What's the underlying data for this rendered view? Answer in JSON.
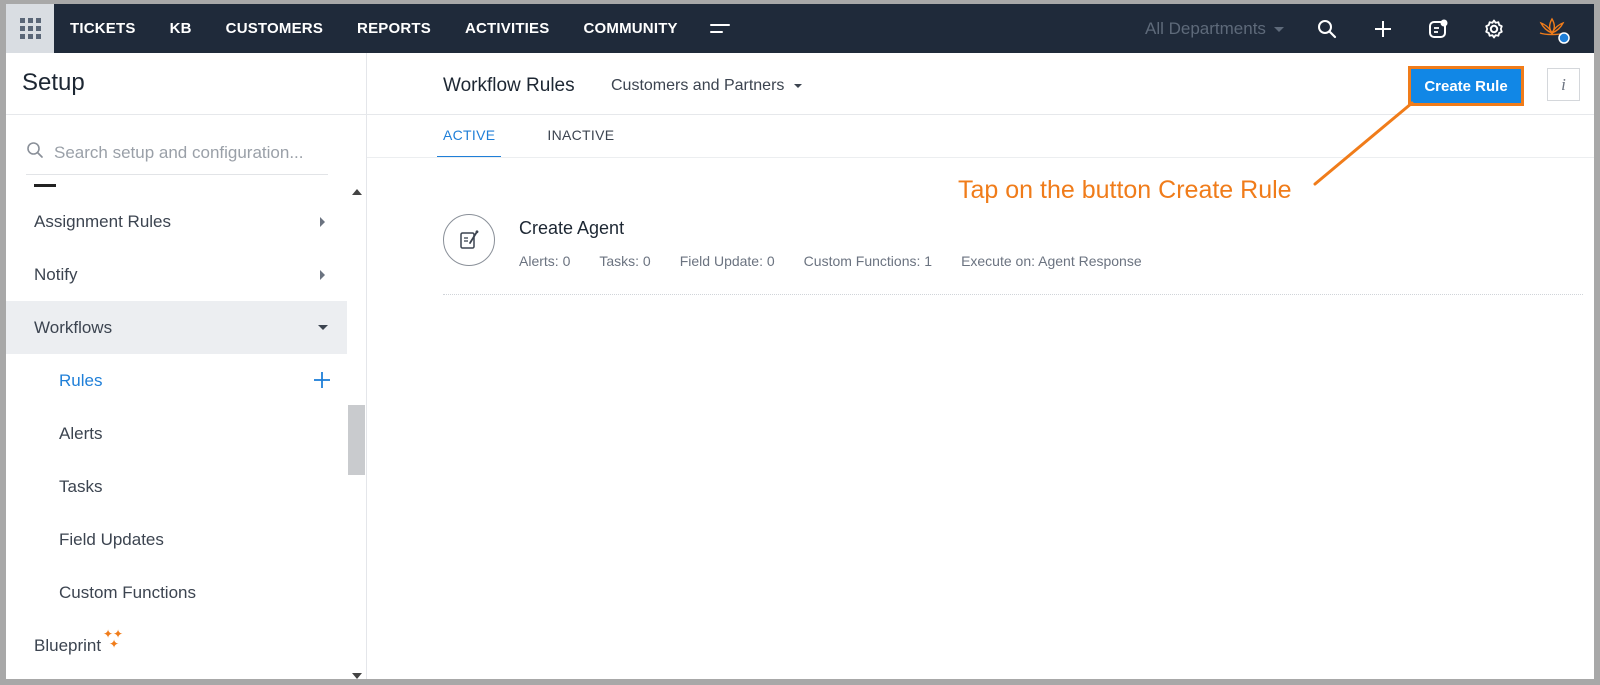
{
  "topbar": {
    "nav": [
      "TICKETS",
      "KB",
      "CUSTOMERS",
      "REPORTS",
      "ACTIVITIES",
      "COMMUNITY"
    ],
    "department_label": "All Departments"
  },
  "sidebar": {
    "title": "Setup",
    "search_placeholder": "Search setup and configuration...",
    "items": [
      {
        "label": "Assignment Rules"
      },
      {
        "label": "Notify"
      },
      {
        "label": "Workflows"
      },
      {
        "label": "Rules"
      },
      {
        "label": "Alerts"
      },
      {
        "label": "Tasks"
      },
      {
        "label": "Field Updates"
      },
      {
        "label": "Custom Functions"
      },
      {
        "label": "Blueprint"
      }
    ]
  },
  "main": {
    "title": "Workflow Rules",
    "department_filter": "Customers and Partners",
    "create_button": "Create Rule",
    "info_label": "i",
    "tabs": [
      "ACTIVE",
      "INACTIVE"
    ],
    "rules": [
      {
        "name": "Create Agent",
        "meta": [
          "Alerts: 0",
          "Tasks: 0",
          "Field Update: 0",
          "Custom Functions: 1",
          "Execute on: Agent Response"
        ]
      }
    ]
  },
  "annotation": {
    "text": "Tap on the button Create Rule",
    "color": "#f07c1a"
  },
  "colors": {
    "topbar": "#1f2a3a",
    "accent": "#1187e6",
    "link": "#1f7fd8",
    "highlight": "#f07c1a"
  }
}
